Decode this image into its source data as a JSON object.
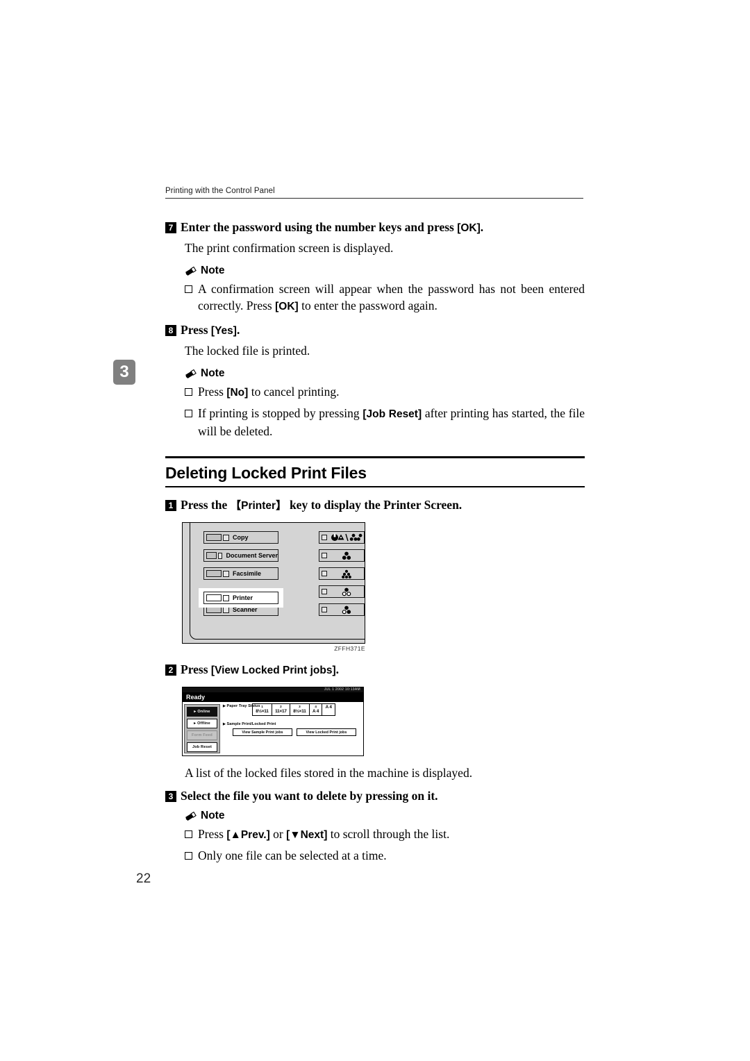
{
  "running_head": "Printing with the Control Panel",
  "chapter_tab": "3",
  "page_number": "22",
  "steps": {
    "step7": {
      "num": "7",
      "text_a": "Enter the password using the number keys and press ",
      "key": "[OK]",
      "text_b": ".",
      "body": "The print confirmation screen is displayed.",
      "note_label": "Note",
      "note_items": [
        {
          "a": "A confirmation screen will appear when the password has not been entered correctly. Press ",
          "key": "[OK]",
          "b": " to enter the password again."
        }
      ]
    },
    "step8": {
      "num": "8",
      "text_a": "Press ",
      "key": "[Yes]",
      "text_b": ".",
      "body": "The locked file is printed.",
      "note_label": "Note",
      "note_items": [
        {
          "a": "Press ",
          "key": "[No]",
          "b": " to cancel printing."
        },
        {
          "a": "If printing is stopped by pressing ",
          "key": "[Job Reset]",
          "b": " after printing has started, the file will be deleted."
        }
      ]
    }
  },
  "section": {
    "title": "Deleting Locked Print Files",
    "step1": {
      "num": "1",
      "text_a": "Press the ",
      "key": "【Printer】",
      "text_b": " key to display the Printer Screen."
    },
    "step2": {
      "num": "2",
      "text_a": "Press ",
      "key": "[View Locked Print jobs]",
      "text_b": "."
    },
    "step2_body": "A list of the locked files stored in the machine is displayed.",
    "step3": {
      "num": "3",
      "text": "Select the file you want to delete by pressing on it.",
      "note_label": "Note",
      "note_items": [
        {
          "a": "Press ",
          "key": "[▲Prev.]",
          "mid": " or ",
          "key2": "[▼Next]",
          "b": " to scroll through the list."
        },
        {
          "a": "Only one file can be selected at a time.",
          "key": "",
          "b": ""
        }
      ]
    }
  },
  "control_panel_figure": {
    "caption": "ZFFH371E",
    "keys": [
      {
        "label": "Copy"
      },
      {
        "label": "Document Server"
      },
      {
        "label": "Facsimile"
      },
      {
        "label": "Printer",
        "highlighted": true
      },
      {
        "label": "Scanner"
      }
    ],
    "indicators": [
      {
        "name": "alert-and-toner-indicator"
      },
      {
        "name": "three-dots-filled-indicator"
      },
      {
        "name": "five-dots-indicator"
      },
      {
        "name": "one-filled-two-open-indicator"
      },
      {
        "name": "two-filled-one-open-indicator"
      }
    ]
  },
  "lcd_figure": {
    "topbar_text": "JUL  1 2002 10:13AM",
    "status": "Ready",
    "side_buttons": [
      {
        "label": "Online",
        "state": "on"
      },
      {
        "label": "Offline",
        "state": "off"
      },
      {
        "label": "Form Feed",
        "state": "dim"
      },
      {
        "label": "Job Reset",
        "state": "off"
      }
    ],
    "row1_label": "Paper Tray Status",
    "trays": [
      {
        "num": "1",
        "size": "8½×11"
      },
      {
        "num": "2",
        "size": "11×17"
      },
      {
        "num": "3",
        "size": "8½×11"
      },
      {
        "num": "4",
        "size": "A 4"
      },
      {
        "num": "",
        "size": "A 4"
      }
    ],
    "row2_label": "Sample Print/Locked Print",
    "buttons": [
      {
        "label": "View Sample Print jobs"
      },
      {
        "label": "View Locked Print jobs"
      }
    ]
  }
}
